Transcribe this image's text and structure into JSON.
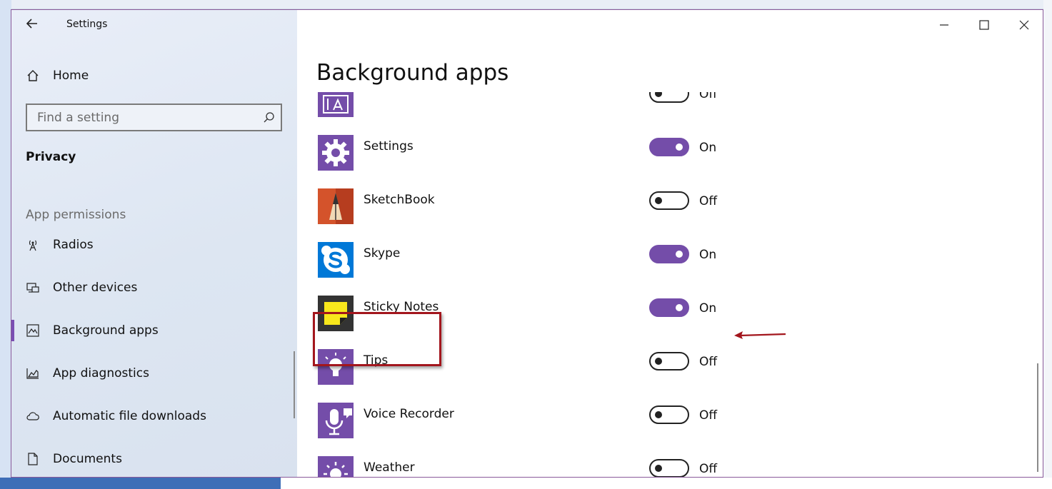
{
  "window": {
    "title": "Settings"
  },
  "sidebar": {
    "home_label": "Home",
    "search_placeholder": "Find a setting",
    "section_title": "Privacy",
    "group_title": "App permissions",
    "items": [
      {
        "label": "Radios",
        "icon": "radio-tower-icon"
      },
      {
        "label": "Other devices",
        "icon": "devices-icon"
      },
      {
        "label": "Background apps",
        "icon": "background-apps-icon",
        "active": true
      },
      {
        "label": "App diagnostics",
        "icon": "diagnostics-icon"
      },
      {
        "label": "Automatic file downloads",
        "icon": "cloud-icon"
      },
      {
        "label": "Documents",
        "icon": "document-icon"
      }
    ]
  },
  "main": {
    "title": "Background apps",
    "apps": [
      {
        "name": "Settings",
        "state": "On",
        "icon": "gear-icon",
        "tile_color": "#744da9"
      },
      {
        "name": "SketchBook",
        "state": "Off",
        "icon": "pencil-icon",
        "tile_color": "#d4532b"
      },
      {
        "name": "Skype",
        "state": "On",
        "icon": "skype-icon",
        "tile_color": "#0078d7"
      },
      {
        "name": "Sticky Notes",
        "state": "On",
        "icon": "sticky-note-icon",
        "tile_color": "#333333"
      },
      {
        "name": "Tips",
        "state": "Off",
        "icon": "lightbulb-icon",
        "tile_color": "#744da9"
      },
      {
        "name": "Voice Recorder",
        "state": "Off",
        "icon": "microphone-icon",
        "tile_color": "#744da9"
      },
      {
        "name": "Weather",
        "state": "Off",
        "icon": "sun-icon",
        "tile_color": "#744da9"
      }
    ],
    "partial_top": {
      "state": "Off",
      "icon": "print-3d-icon",
      "tile_color": "#744da9"
    }
  },
  "annotation": {
    "color": "#a3161d"
  },
  "colors": {
    "accent": "#744da9"
  }
}
